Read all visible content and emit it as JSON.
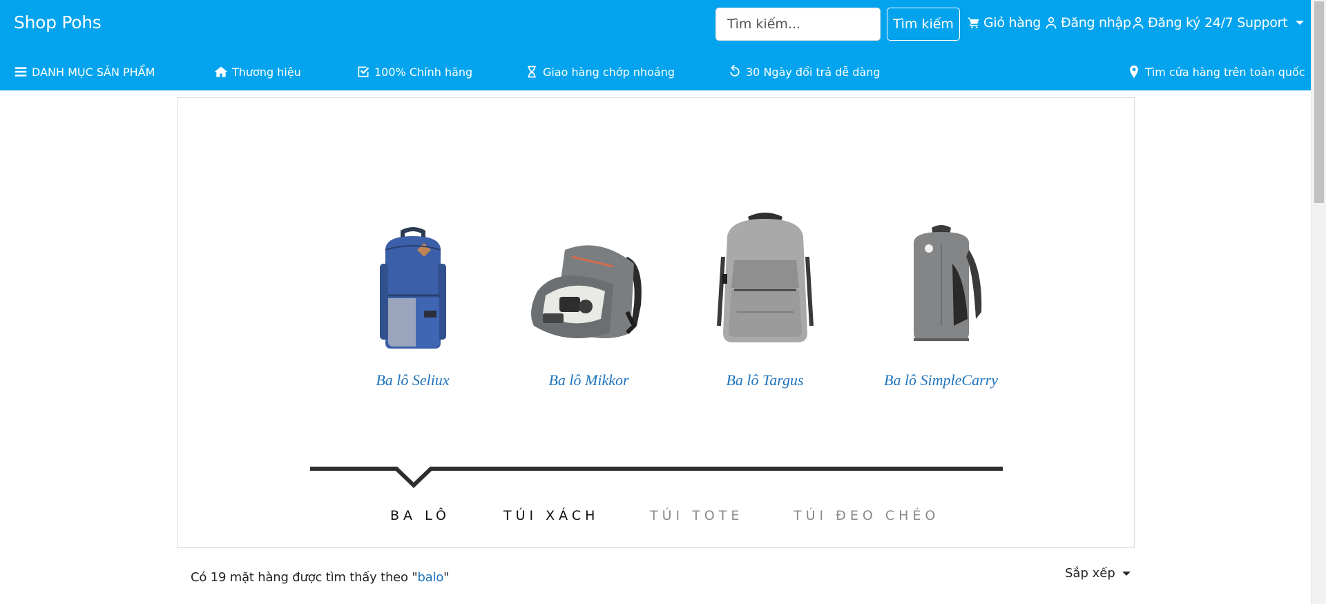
{
  "header": {
    "brand": "Shop Pohs",
    "search": {
      "placeholder": "Tìm kiếm...",
      "button_label": "Tìm kiếm"
    },
    "links": {
      "cart": "Giỏ hàng",
      "login": "Đăng nhập",
      "register": "Đăng ký",
      "support": "24/7 Support"
    }
  },
  "category_bar": {
    "menu": "DANH MỤC SẢN PHẨM",
    "brands": "Thương hiệu",
    "genuine": "100% Chính hãng",
    "delivery": "Giao hàng chớp nhoáng",
    "returns": "30 Ngày đổi trả dễ dàng",
    "stores": "Tìm cửa hàng trên toàn quốc"
  },
  "banner": {
    "products": [
      {
        "name": "Ba lô Seliux",
        "icon": "blue-backpack-image"
      },
      {
        "name": "Ba lô Mikkor",
        "icon": "camera-backpack-image"
      },
      {
        "name": "Ba lô Targus",
        "icon": "grey-laptop-backpack-image"
      },
      {
        "name": "Ba lô SimpleCarry",
        "icon": "grey-slim-backpack-image"
      }
    ],
    "tabs": [
      "BA LÔ",
      "TÚI XÁCH",
      "TÚI TOTE",
      "TÚI ĐEO CHÉO"
    ],
    "active_tab": 0
  },
  "results": {
    "prefix": "Có 19 mặt hàng được tìm thấy theo \"",
    "keyword": "balo",
    "suffix": "\"",
    "sort_label": "Sắp xếp"
  },
  "colors": {
    "primary": "#03a4ed",
    "link": "#1e73be"
  }
}
